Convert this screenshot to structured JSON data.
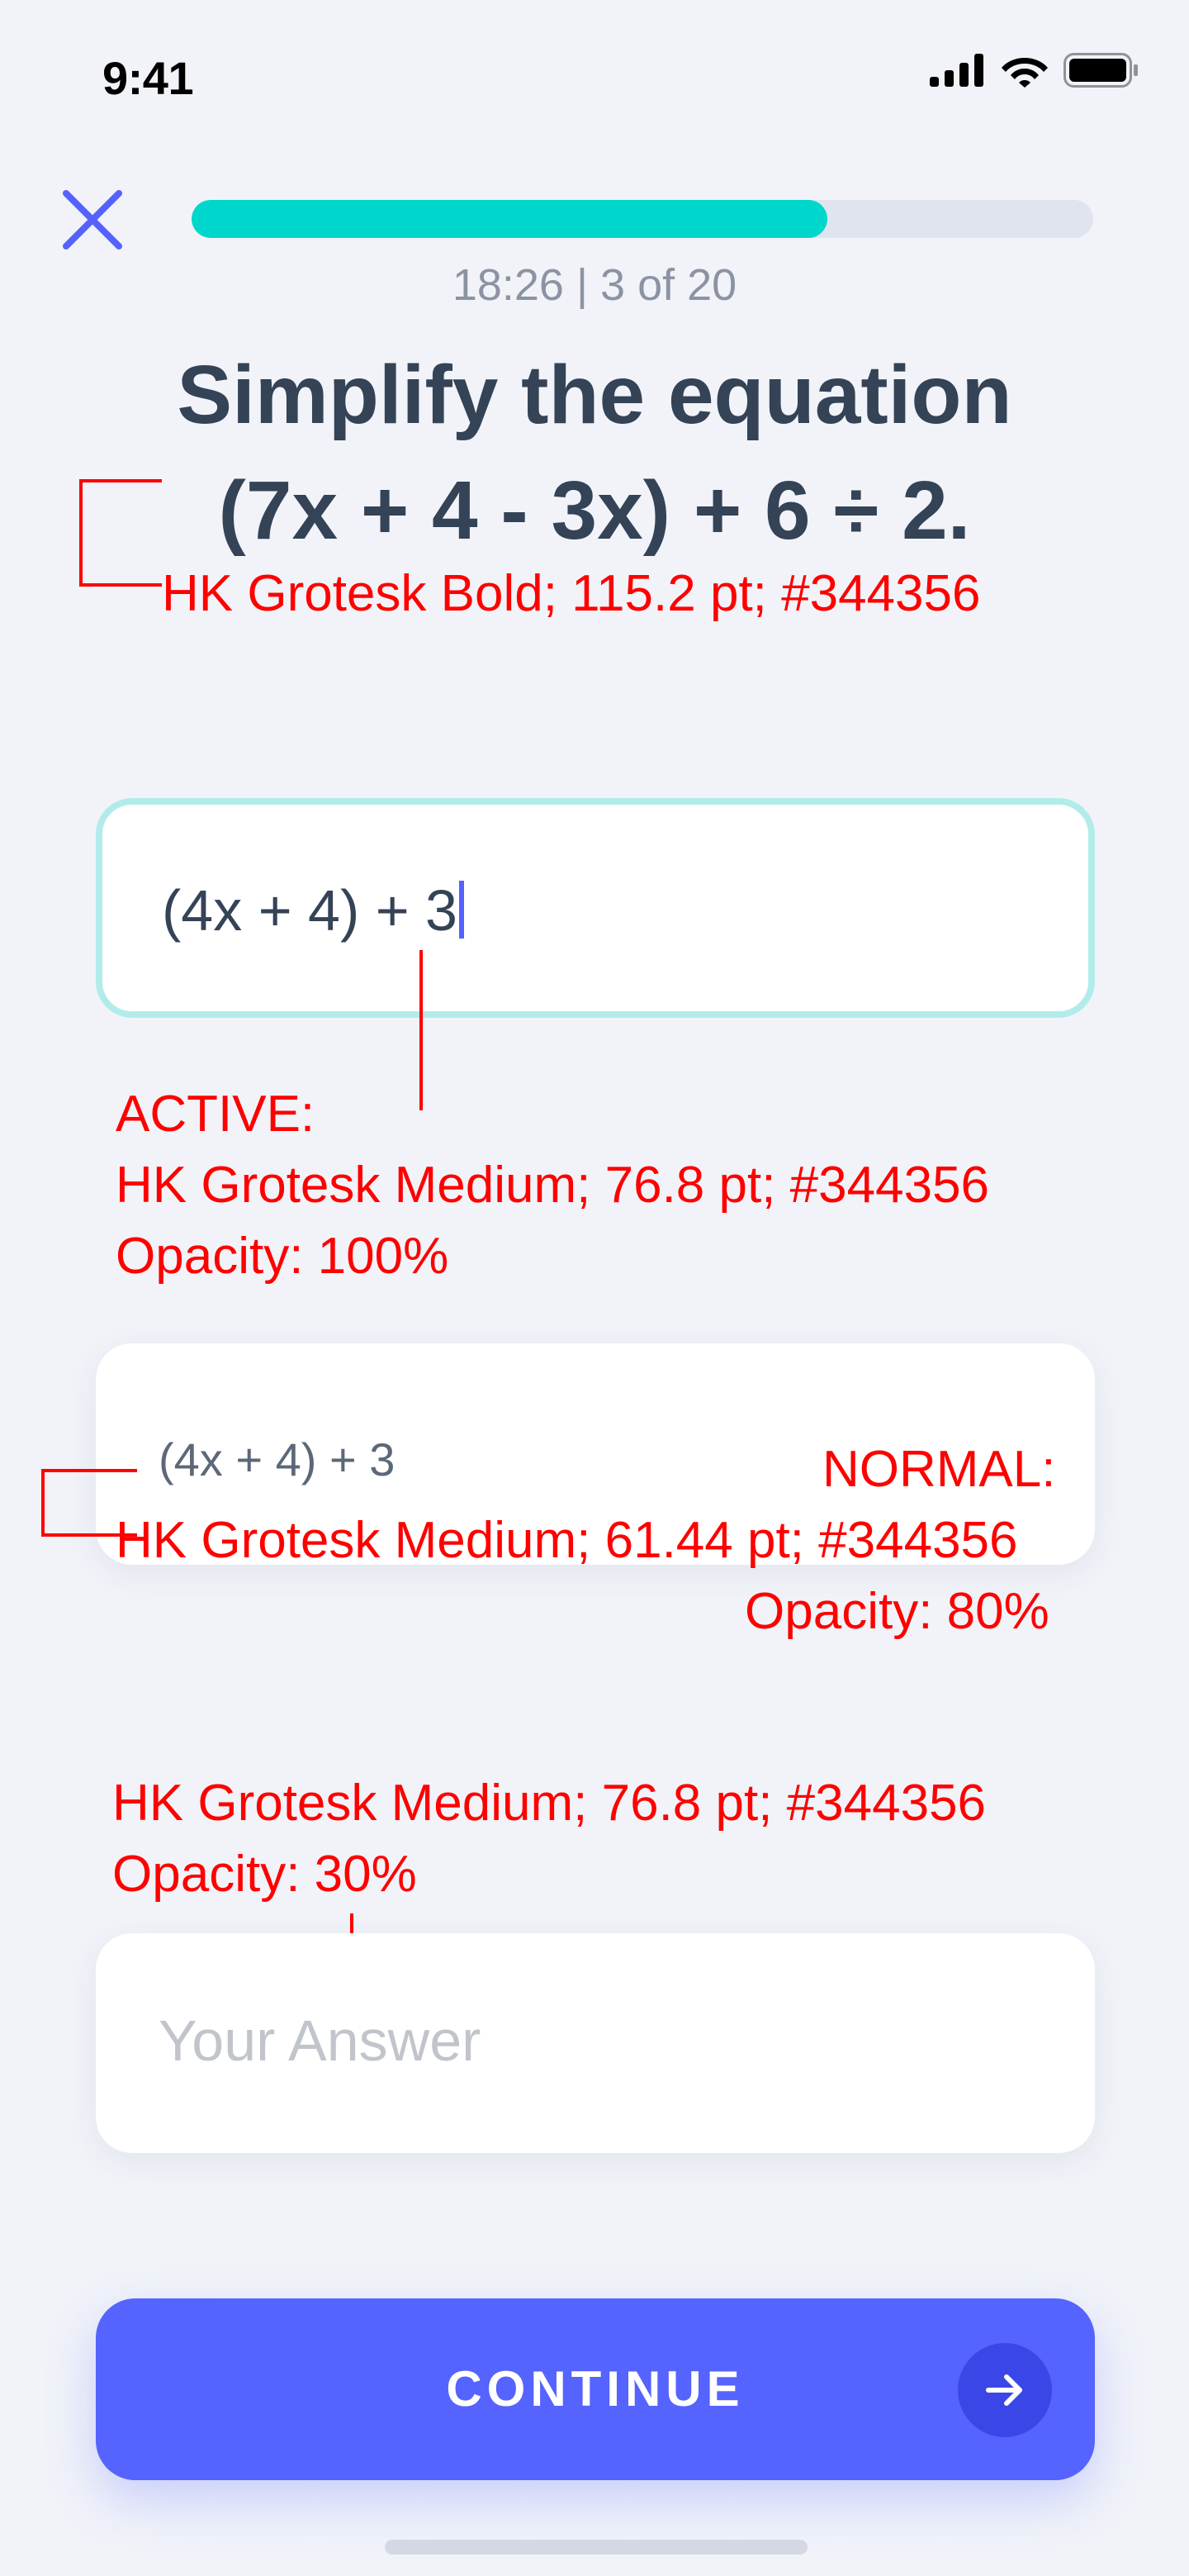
{
  "status_bar": {
    "time": "9:41"
  },
  "header": {
    "progress_fraction": 0.705,
    "timer": "18:26",
    "separator": "|",
    "progress_text": "3 of 20"
  },
  "question": {
    "line1": "Simplify the equation",
    "line2": "(7x + 4 - 3x) + 6 ÷ 2."
  },
  "inputs": {
    "active_value": "(4x + 4) + 3",
    "normal_value": "(4x + 4) + 3",
    "empty_placeholder": "Your Answer"
  },
  "annotations": {
    "title_spec": "HK Grotesk Bold; 115.2 pt; #344356",
    "active_label": "ACTIVE:",
    "active_spec": "HK Grotesk Medium; 76.8 pt; #344356",
    "active_opacity": "Opacity: 100%",
    "normal_label": "NORMAL:",
    "normal_spec": "HK Grotesk Medium; 61.44 pt; #344356",
    "normal_opacity": "Opacity: 80%",
    "placeholder_spec": "HK Grotesk Medium; 76.8 pt; #344356",
    "placeholder_opacity": "Opacity: 30%"
  },
  "continue_button": {
    "label": "CONTINUE"
  },
  "colors": {
    "text": "#344356",
    "accent": "#5563ff",
    "progress": "#00d7cc",
    "annotation": "#ff0000"
  },
  "icons": [
    "signal-icon",
    "wifi-icon",
    "battery-icon",
    "close-icon",
    "arrow-right-icon"
  ]
}
